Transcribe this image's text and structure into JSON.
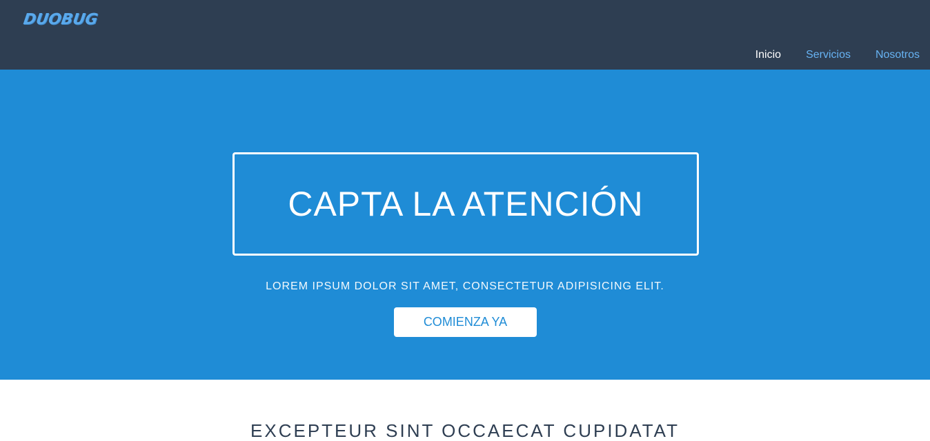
{
  "brand": {
    "logo_text": "DUOBUG",
    "logo_color": "#5aa9ec"
  },
  "nav": {
    "items": [
      {
        "label": "Inicio",
        "active": true
      },
      {
        "label": "Servicios",
        "active": false
      },
      {
        "label": "Nosotros",
        "active": false
      }
    ]
  },
  "hero": {
    "title": "CAPTA LA ATENCIÓN",
    "subtitle": "LOREM IPSUM DOLOR SIT AMET, CONSECTETUR ADIPISICING ELIT.",
    "cta_label": "COMIENZA YA",
    "background_color": "#1f8cd6"
  },
  "section": {
    "heading": "EXCEPTEUR SINT OCCAECAT CUPIDATAT"
  },
  "colors": {
    "navbar": "#2e3e52",
    "link": "#67b3f3",
    "active_link": "#ffffff"
  }
}
